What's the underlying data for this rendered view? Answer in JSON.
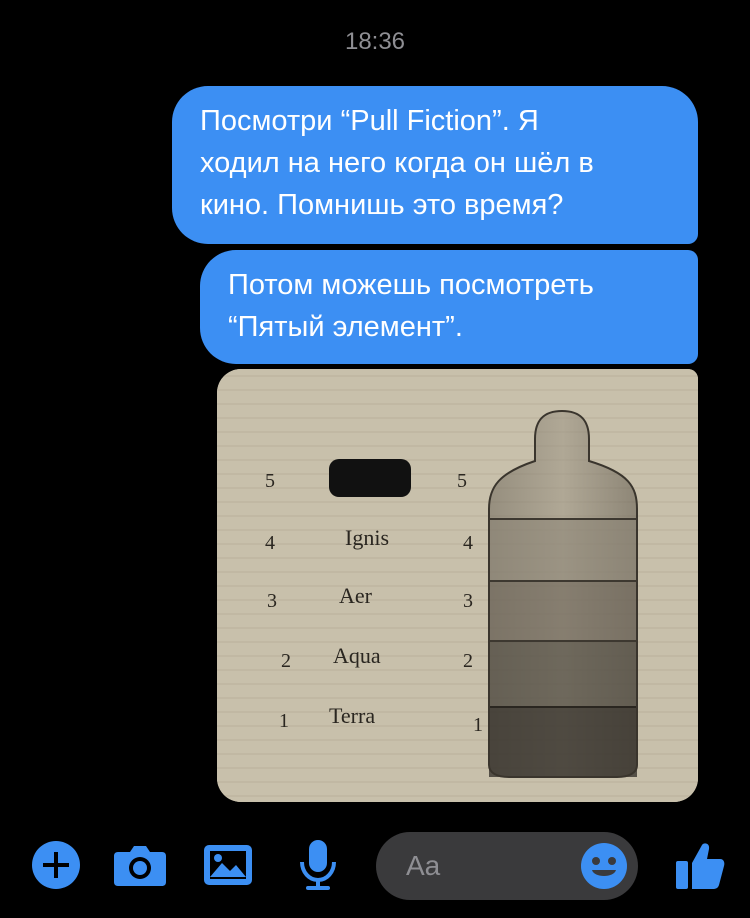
{
  "header": {
    "time": "18:36"
  },
  "messages": [
    {
      "lines": [
        "Посмотри “Pull Fiction”. Я",
        "ходил на него когда он шёл в",
        "кино. Помнишь это время?"
      ]
    },
    {
      "lines": [
        "Потом можешь посмотреть",
        "“Пятый элемент”."
      ]
    }
  ],
  "photo": {
    "rows": [
      {
        "left": "5",
        "name": "",
        "right": "5"
      },
      {
        "left": "4",
        "name": "Ignis",
        "right": "4"
      },
      {
        "left": "3",
        "name": "Aer",
        "right": "3"
      },
      {
        "left": "2",
        "name": "Aqua",
        "right": "2"
      },
      {
        "left": "1",
        "name": "Terra",
        "right": "1"
      }
    ]
  },
  "composer": {
    "placeholder": "Aa",
    "icons": [
      "plus-icon",
      "camera-icon",
      "image-icon",
      "microphone-icon",
      "emoji-icon",
      "thumbs-up-icon"
    ]
  },
  "colors": {
    "accent": "#3c8ff3",
    "background": "#000000",
    "input": "#3a3a3c"
  }
}
